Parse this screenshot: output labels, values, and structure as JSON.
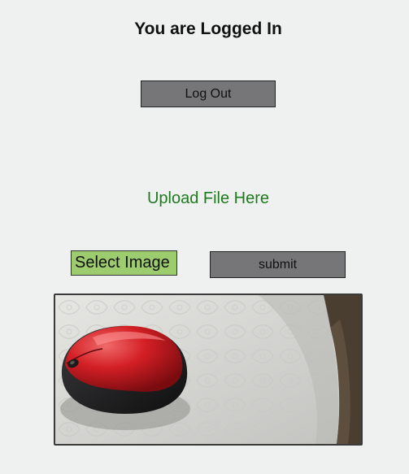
{
  "header": {
    "title": "You are Logged In"
  },
  "actions": {
    "logout_label": "Log Out"
  },
  "upload": {
    "heading": "Upload File Here",
    "select_label": "Select Image",
    "submit_label": "submit"
  },
  "preview": {
    "subject": "red-computer-mouse-photo"
  },
  "colors": {
    "background": "#eff1f0",
    "button_gray": "#767577",
    "upload_heading_green": "#1f7a1f",
    "select_button_green": "#9ccc6e"
  }
}
